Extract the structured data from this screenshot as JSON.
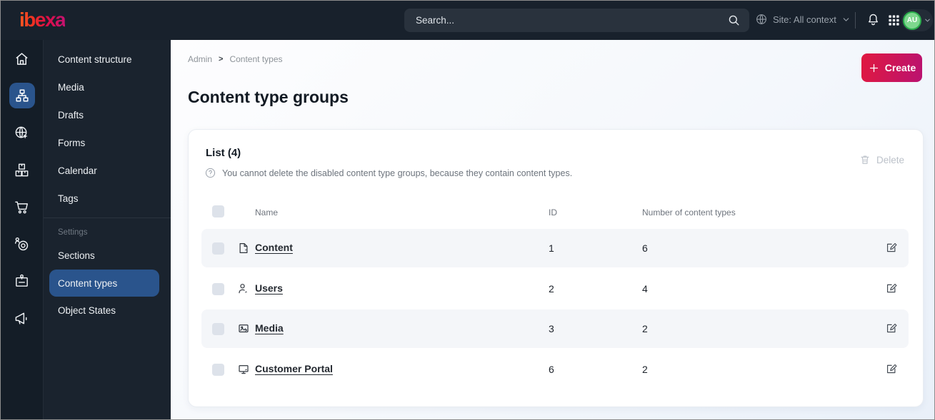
{
  "topbar": {
    "logo_text": "ibexa",
    "search_placeholder": "Search...",
    "site_context_label": "Site: All context",
    "avatar_initials": "AU"
  },
  "sidebar_rail": {
    "items": [
      {
        "icon": "home-icon",
        "selected": false
      },
      {
        "icon": "content-tree-icon",
        "selected": true
      },
      {
        "icon": "site-globe-icon",
        "selected": false
      },
      {
        "icon": "product-boxes-icon",
        "selected": false
      },
      {
        "icon": "cart-icon",
        "selected": false
      },
      {
        "icon": "personalization-target-icon",
        "selected": false
      },
      {
        "icon": "id-badge-icon",
        "selected": false
      },
      {
        "icon": "megaphone-icon",
        "selected": false
      }
    ]
  },
  "sidebar_menu": {
    "items": [
      "Content structure",
      "Media",
      "Drafts",
      "Forms",
      "Calendar",
      "Tags"
    ],
    "settings_section_label": "Settings",
    "settings_items": [
      "Sections",
      "Content types",
      "Object States"
    ],
    "selected_item": "Content types"
  },
  "main": {
    "breadcrumb": {
      "items": [
        "Admin",
        "Content types"
      ],
      "separator": ">"
    },
    "create_button_label": "Create",
    "page_title": "Content type groups",
    "panel": {
      "list_title": "List (4)",
      "info_text": "You cannot delete the disabled content type groups, because they contain content types.",
      "delete_button_label": "Delete",
      "table": {
        "columns": [
          "Name",
          "ID",
          "Number of content types"
        ],
        "rows": [
          {
            "icon": "file-icon",
            "name": "Content",
            "id": "1",
            "content_types_count": "6"
          },
          {
            "icon": "user-icon",
            "name": "Users",
            "id": "2",
            "content_types_count": "4"
          },
          {
            "icon": "image-icon",
            "name": "Media",
            "id": "3",
            "content_types_count": "2"
          },
          {
            "icon": "monitor-icon",
            "name": "Customer Portal",
            "id": "6",
            "content_types_count": "2"
          }
        ]
      }
    }
  },
  "icons": {
    "search-icon": "⌕",
    "globe-icon": "🌐",
    "chevron-down-icon": "⌄",
    "bell-icon": "🔔",
    "app-grid-icon": "⣿",
    "home-icon": "⌂",
    "content-tree-icon": "sitemap",
    "site-globe-icon": "🌐",
    "product-boxes-icon": "📦",
    "cart-icon": "🛒",
    "personalization-target-icon": "🎯",
    "id-badge-icon": "id-badge",
    "megaphone-icon": "📣",
    "plus-icon": "+",
    "question-circle-icon": "?",
    "trash-icon": "🗑",
    "edit-icon": "✎",
    "file-icon": "📄",
    "user-icon": "👤",
    "image-icon": "🖼",
    "monitor-icon": "🖥",
    "checkbox": "☐"
  },
  "colors": {
    "topbar_bg": "#18212c",
    "sidebar_bg": "#1a232e",
    "selected_blue": "#2a548c",
    "create_gradient_start": "#e01940",
    "create_gradient_end": "#ba1270",
    "avatar_green": "#7ed78e",
    "row_alt_bg": "#f4f6f9"
  }
}
